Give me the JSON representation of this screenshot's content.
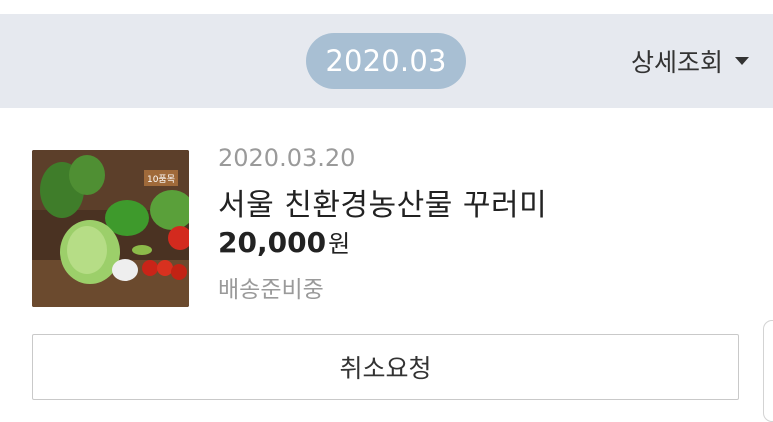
{
  "header": {
    "month": "2020.03",
    "detail_label": "상세조회",
    "detail_icon": "caret-down-icon",
    "colors": {
      "background": "#e6e9ef",
      "month_pill": "#a8bfd3"
    }
  },
  "order": {
    "date": "2020.03.20",
    "product_name": "서울 친환경농산물 꾸러미",
    "price_amount": "20,000",
    "price_unit": "원",
    "status": "배송준비중",
    "thumbnail_badge": "10품목",
    "cancel_label": "취소요청"
  }
}
